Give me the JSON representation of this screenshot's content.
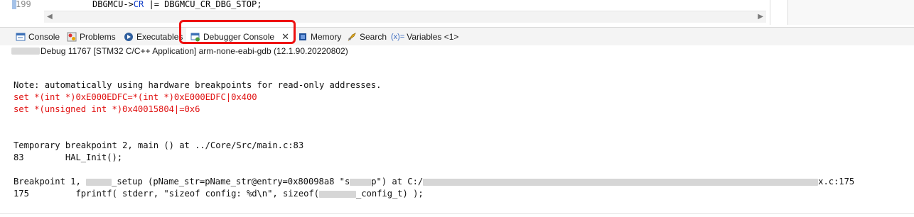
{
  "editor": {
    "line_number": "199",
    "code_prefix": "DBGMCU->",
    "code_keyword": "CR",
    "code_suffix": " |= DBGMCU_CR_DBG_STOP;"
  },
  "tabs": [
    {
      "label": "Console",
      "icon": "console-icon"
    },
    {
      "label": "Problems",
      "icon": "problems-icon"
    },
    {
      "label": "Executables",
      "icon": "executables-icon"
    },
    {
      "label": "Debugger Console",
      "icon": "debugger-console-icon",
      "active": true
    },
    {
      "label": "Memory",
      "icon": "memory-icon"
    },
    {
      "label": "Search",
      "icon": "search-icon"
    },
    {
      "label": "Variables <1>",
      "icon": "variables-icon",
      "icon_text": "(x)="
    }
  ],
  "session": {
    "text": "Debug 11767 [STM32 C/C++ Application] arm-none-eabi-gdb (12.1.90.20220802)"
  },
  "console": {
    "note": "Note: automatically using hardware breakpoints for read-only addresses.",
    "set1": "set *(int *)0xE000EDFC=*(int *)0xE000EDFC|0x400",
    "set2": "set *(unsigned int *)0x40015804|=0x6",
    "temp_bp": "Temporary breakpoint 2, main () at ../Core/Src/main.c:83",
    "line83": "83        HAL_Init();",
    "bp1_a": "Breakpoint 1, ",
    "bp1_b": "_setup (pName_str=pName_str@entry=0x80098a8 \"s",
    "bp1_c": "p\") at C:/",
    "bp1_d": "x.c:175",
    "line175_a": "175         fprintf( stderr, \"sizeof config: %d\\n\", sizeof(",
    "line175_b": "_config_t) );"
  },
  "colors": {
    "highlight": "#ee1111",
    "error_text": "#e01010"
  }
}
